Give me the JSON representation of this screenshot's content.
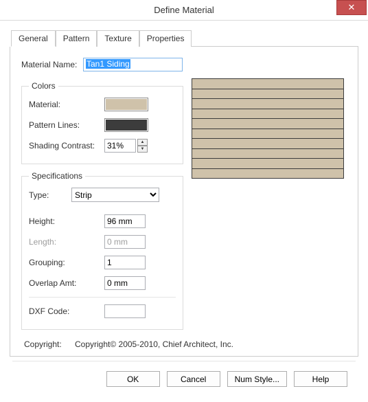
{
  "window": {
    "title": "Define Material",
    "close_glyph": "✕"
  },
  "tabs": [
    "General",
    "Pattern",
    "Texture",
    "Properties"
  ],
  "material_name": {
    "label": "Material Name:",
    "value": "Tan1 Siding"
  },
  "colors_group": {
    "legend": "Colors",
    "material_label": "Material:",
    "material_color": "#cfc2aa",
    "pattern_label": "Pattern Lines:",
    "pattern_color": "#3c3c3c",
    "contrast_label": "Shading Contrast:",
    "contrast_value": "31%"
  },
  "spec_group": {
    "legend": "Specifications",
    "type_label": "Type:",
    "type_value": "Strip",
    "height_label": "Height:",
    "height_value": "96 mm",
    "length_label": "Length:",
    "length_value": "0 mm",
    "grouping_label": "Grouping:",
    "grouping_value": "1",
    "overlap_label": "Overlap Amt:",
    "overlap_value": "0 mm",
    "dxf_label": "DXF Code:",
    "dxf_value": ""
  },
  "copyright": {
    "label": "Copyright:",
    "text": "Copyright© 2005-2010, Chief Architect, Inc."
  },
  "buttons": {
    "ok": "OK",
    "cancel": "Cancel",
    "numstyle": "Num Style...",
    "help": "Help"
  },
  "spinner": {
    "up": "▲",
    "down": "▼"
  }
}
